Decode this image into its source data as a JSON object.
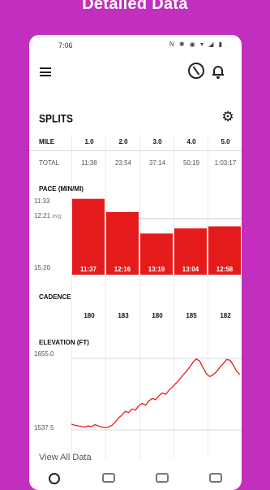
{
  "promo": {
    "title": "Detailed Data"
  },
  "status": {
    "time": "7:06",
    "icons": "N ✱ ◉ ▾ ◢ ▮"
  },
  "splits": {
    "title": "SPLITS",
    "mile_label": "MILE",
    "total_label": "TOTAL",
    "miles": [
      "1.0",
      "2.0",
      "3.0",
      "4.0",
      "5.0"
    ],
    "totals": [
      "11:38",
      "23:54",
      "37:14",
      "50:19",
      "1:03:17"
    ]
  },
  "pace": {
    "label": "PACE (MIN/MI)",
    "top_label": "11:33",
    "avg_label": "12:21",
    "avg_suffix": "avg",
    "bottom_label": "15:20",
    "bar_labels": [
      "11:37",
      "12:16",
      "13:19",
      "13:04",
      "12:58"
    ],
    "color": "#e51b1b"
  },
  "cadence": {
    "label": "CADENCE",
    "values": [
      "180",
      "183",
      "180",
      "185",
      "182"
    ]
  },
  "elevation": {
    "label": "ELEVATION (FT)",
    "top_label": "1655.0",
    "bottom_label": "1537.5",
    "color": "#e51b1b"
  },
  "footer": {
    "view_all": "View All Data"
  },
  "nav_icons": [
    "runner-icon",
    "card-icon",
    "shoe-icon",
    "calendar-icon"
  ],
  "chart_data": [
    {
      "type": "bar",
      "title": "PACE (MIN/MI)",
      "categories": [
        "1.0",
        "2.0",
        "3.0",
        "4.0",
        "5.0"
      ],
      "values": [
        "11:37",
        "12:16",
        "13:19",
        "13:04",
        "12:58"
      ],
      "ylim": [
        "15:20",
        "11:33"
      ],
      "avg": "12:21"
    },
    {
      "type": "line",
      "title": "ELEVATION (FT)",
      "ylim": [
        1537.5,
        1655.0
      ],
      "x": [
        0,
        0.1,
        0.2,
        0.3,
        0.4,
        0.5,
        0.6,
        0.7,
        0.8,
        0.9,
        1.0,
        1.1,
        1.2,
        1.3,
        1.4,
        1.5,
        1.6,
        1.7,
        1.8,
        1.9,
        2.0,
        2.1,
        2.2,
        2.3,
        2.4,
        2.5,
        2.6,
        2.7,
        2.8,
        2.9,
        3.0,
        3.1,
        3.2,
        3.3,
        3.4,
        3.5,
        3.6,
        3.7,
        3.8,
        3.9,
        4.0,
        4.1,
        4.2,
        4.3,
        4.4,
        4.5,
        4.6,
        4.7,
        4.8,
        4.9,
        5.0
      ],
      "y": [
        1547,
        1545,
        1544,
        1543,
        1542,
        1544,
        1543,
        1546,
        1544,
        1542,
        1541,
        1542,
        1545,
        1550,
        1557,
        1562,
        1568,
        1566,
        1572,
        1570,
        1577,
        1581,
        1578,
        1585,
        1589,
        1587,
        1594,
        1598,
        1596,
        1603,
        1608,
        1614,
        1620,
        1627,
        1633,
        1640,
        1648,
        1654,
        1651,
        1640,
        1630,
        1625,
        1628,
        1633,
        1640,
        1646,
        1653,
        1652,
        1644,
        1634,
        1628
      ]
    }
  ]
}
